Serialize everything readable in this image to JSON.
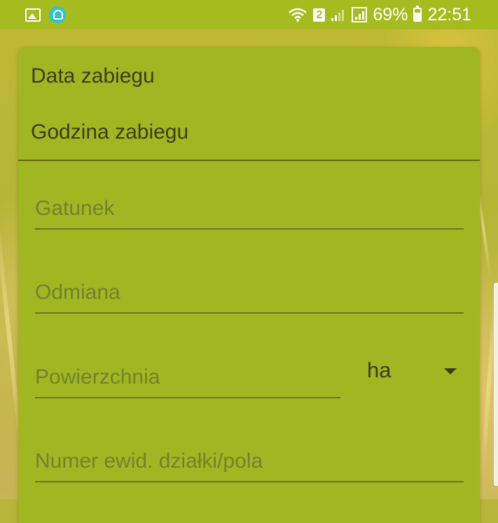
{
  "status_bar": {
    "left_icons": [
      "gallery-icon",
      "cloud-notification-icon"
    ],
    "right_icons": [
      "wifi-icon",
      "sim2-badge-icon",
      "signal-icon",
      "signal-icon-2",
      "battery-icon"
    ],
    "sim_badge": "2",
    "battery_percent": "69%",
    "battery_level": 0.69,
    "time": "22:51"
  },
  "form": {
    "data_zabiegu_label": "Data zabiegu",
    "godzina_zabiegu_label": "Godzina zabiegu",
    "gatunek_placeholder": "Gatunek",
    "odmiana_placeholder": "Odmiana",
    "powierzchnia_placeholder": "Powierzchnia",
    "unit_selected": "ha",
    "numer_placeholder": "Numer ewid. działki/pola"
  },
  "colors": {
    "status_bar": "#a6bc1e",
    "card": "#a0b721",
    "text_dark": "#3a3d18",
    "hint_text": "#73822f"
  }
}
